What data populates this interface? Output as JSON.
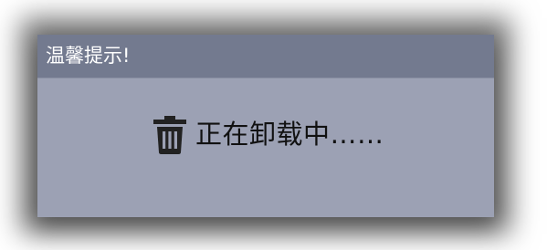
{
  "dialog": {
    "title": "温馨提示!",
    "message": "正在卸载中……",
    "icon": "trash-icon",
    "colors": {
      "titlebar": "#737a8f",
      "body": "#9ca1b4",
      "title_text": "#ffffff",
      "message_text": "#111111",
      "icon": "#222222"
    }
  }
}
